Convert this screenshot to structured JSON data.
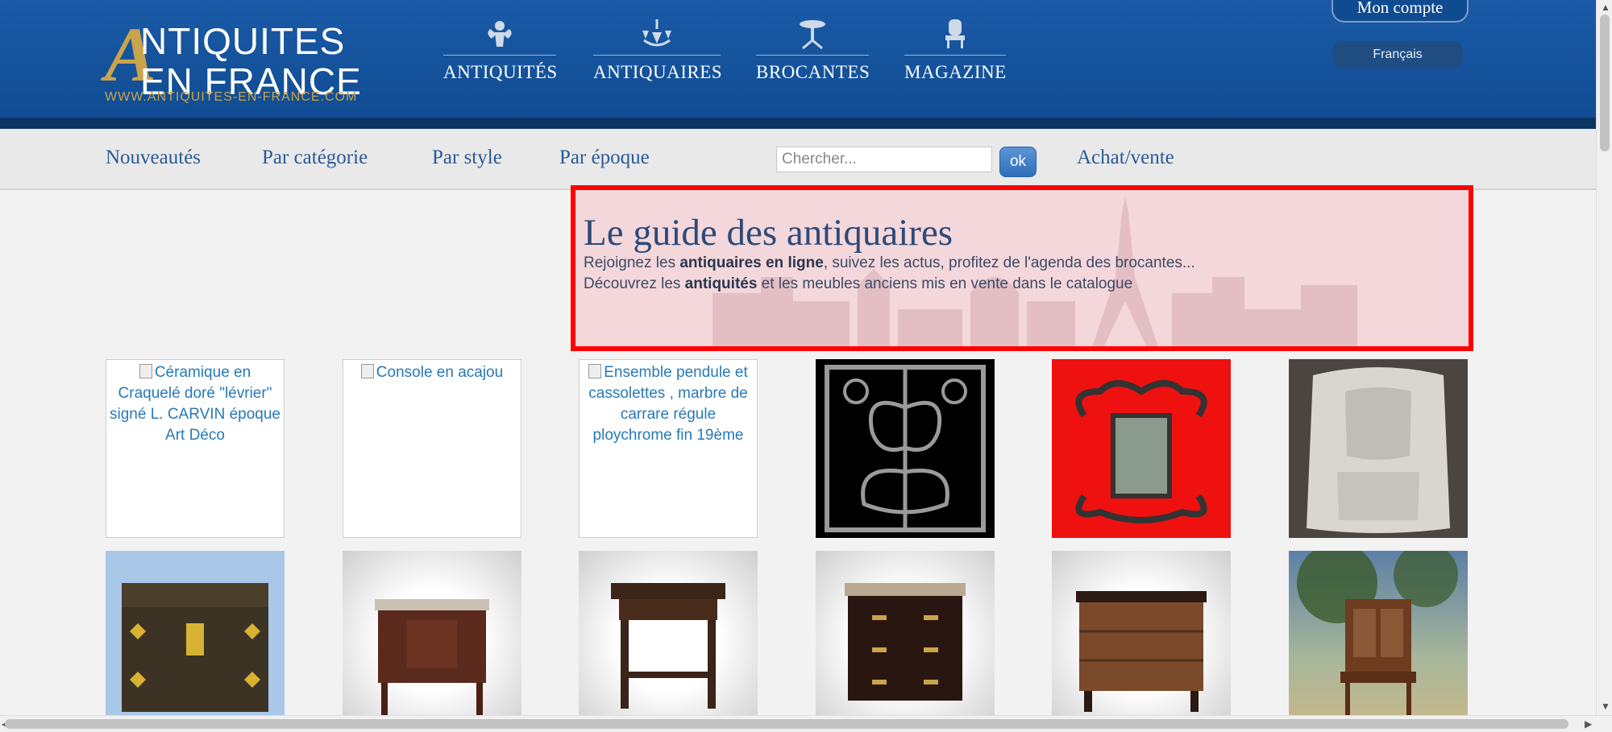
{
  "header": {
    "logo": {
      "line1": "NTIQUITES",
      "initial": "A",
      "line2": "EN FRANCE",
      "url": "WWW.ANTIQUITES-EN-FRANCE.COM"
    },
    "main_nav": [
      {
        "label": "ANTIQUITÉS",
        "icon": "angel-icon"
      },
      {
        "label": "ANTIQUAIRES",
        "icon": "chandelier-icon"
      },
      {
        "label": "BROCANTES",
        "icon": "pedestal-table-icon"
      },
      {
        "label": "MAGAZINE",
        "icon": "chair-icon"
      }
    ],
    "account_label": "Mon compte",
    "language_label": "Français"
  },
  "subnav": {
    "links": [
      "Nouveautés",
      "Par catégorie",
      "Par style",
      "Par époque"
    ],
    "search_placeholder": "Chercher...",
    "ok_label": "ok",
    "buy_sell_label": "Achat/vente"
  },
  "guide": {
    "title": "Le guide des antiquaires",
    "line1": {
      "before": "Rejoignez les ",
      "bold": "antiquaires en ligne",
      "after": ", suivez les actus, profitez de l'agenda des brocantes..."
    },
    "line2": {
      "before": "Découvrez les ",
      "bold": "antiquités",
      "after": " et les meubles anciens mis en vente dans le catalogue"
    }
  },
  "products": [
    {
      "alt": "Céramique en Craquelé doré \"lévrier\" signé L. CARVIN époque Art Déco",
      "broken": true
    },
    {
      "alt": "Console en acajou",
      "broken": true
    },
    {
      "alt": "Ensemble pendule et cassolettes , marbre de carrare régule ploychrome fin 19ème",
      "broken": true
    },
    {
      "image": "wrought-iron-grille",
      "broken": false
    },
    {
      "image": "wrought-iron-lantern",
      "broken": false
    },
    {
      "image": "frosted-glass-lamp",
      "broken": false
    },
    {
      "image": "wooden-chest",
      "broken": false
    },
    {
      "image": "mahogany-console",
      "broken": false
    },
    {
      "image": "side-table",
      "broken": false
    },
    {
      "image": "marble-top-commode",
      "broken": false
    },
    {
      "image": "chest-of-drawers",
      "broken": false
    },
    {
      "image": "bureau-cabinet",
      "broken": false
    }
  ],
  "colors": {
    "header_blue": "#0f4b91",
    "gold": "#c9a44a",
    "link_blue": "#2a5a96",
    "highlight_red": "#ff0000"
  }
}
